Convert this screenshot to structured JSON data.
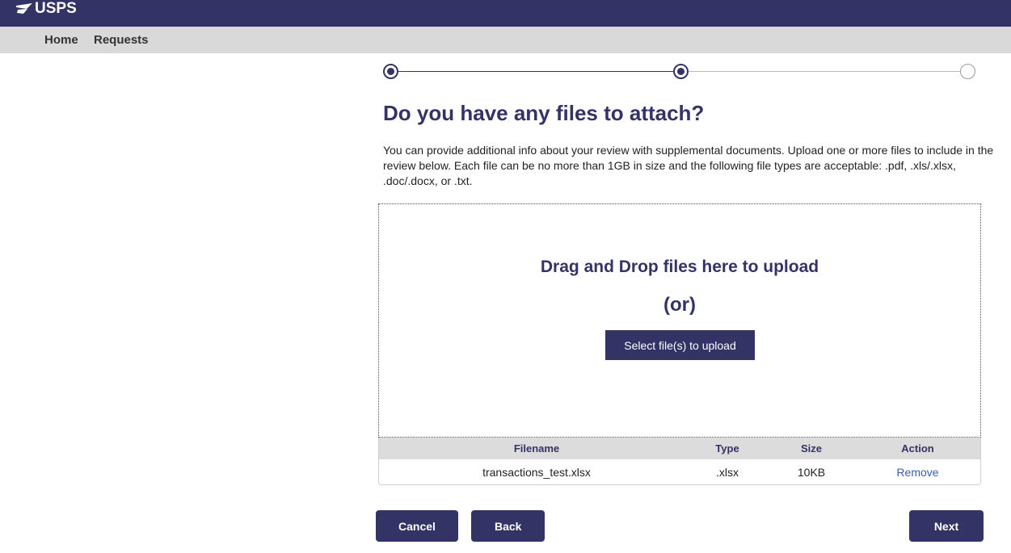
{
  "header": {
    "logo_text": "USPS",
    "logo_icon": "eagle-logo-icon",
    "brand_color": "#333366"
  },
  "nav": {
    "items": [
      {
        "label": "Home"
      },
      {
        "label": "Requests"
      }
    ]
  },
  "stepper": {
    "steps": [
      {
        "state": "completed"
      },
      {
        "state": "current"
      },
      {
        "state": "upcoming"
      }
    ]
  },
  "main": {
    "title": "Do you have any files to attach?",
    "description": "You can provide additional info about your review with supplemental documents. Upload one or more files to include in the review below. Each file can be no more than 1GB in size and the following file types are acceptable: .pdf, .xls/.xlsx, .doc/.docx, or .txt."
  },
  "dropzone": {
    "title": "Drag and Drop files here to upload",
    "or_text": "(or)",
    "select_button": "Select file(s) to upload"
  },
  "file_table": {
    "columns": [
      "Filename",
      "Type",
      "Size",
      "Action"
    ],
    "rows": [
      {
        "filename": "transactions_test.xlsx",
        "type": ".xlsx",
        "size": "10KB",
        "action": "Remove"
      }
    ]
  },
  "actions": {
    "cancel": "Cancel",
    "back": "Back",
    "next": "Next"
  }
}
